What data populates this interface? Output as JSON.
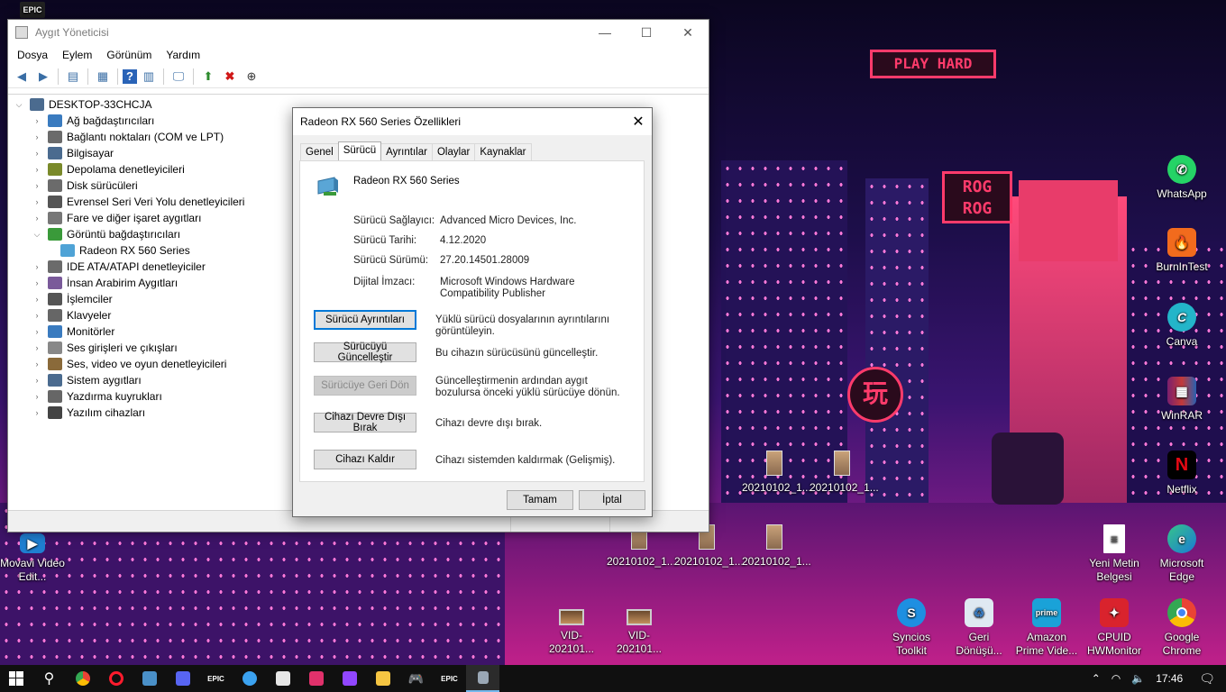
{
  "device_manager": {
    "title": "Aygıt Yöneticisi",
    "menu": [
      "Dosya",
      "Eylem",
      "Görünüm",
      "Yardım"
    ],
    "tree": {
      "root": "DESKTOP-33CHCJA",
      "items": [
        {
          "label": "Ağ bağdaştırıcıları",
          "icon": "network-icon",
          "expanded": false
        },
        {
          "label": "Bağlantı noktaları (COM ve LPT)",
          "icon": "port-icon",
          "expanded": false
        },
        {
          "label": "Bilgisayar",
          "icon": "computer-icon",
          "expanded": false
        },
        {
          "label": "Depolama denetleyicileri",
          "icon": "storage-icon",
          "expanded": false
        },
        {
          "label": "Disk sürücüleri",
          "icon": "disk-icon",
          "expanded": false
        },
        {
          "label": "Evrensel Seri Veri Yolu denetleyicileri",
          "icon": "usb-icon",
          "expanded": false
        },
        {
          "label": "Fare ve diğer işaret aygıtları",
          "icon": "mouse-icon",
          "expanded": false
        },
        {
          "label": "Görüntü bağdaştırıcıları",
          "icon": "display-adapter-icon",
          "expanded": true
        },
        {
          "label": "Radeon RX 560 Series",
          "icon": "gpu-icon",
          "child": true
        },
        {
          "label": "IDE ATA/ATAPI denetleyiciler",
          "icon": "ide-icon",
          "expanded": false
        },
        {
          "label": "İnsan Arabirim Aygıtları",
          "icon": "hid-icon",
          "expanded": false
        },
        {
          "label": "İşlemciler",
          "icon": "cpu-icon",
          "expanded": false
        },
        {
          "label": "Klavyeler",
          "icon": "keyboard-icon",
          "expanded": false
        },
        {
          "label": "Monitörler",
          "icon": "monitor-icon",
          "expanded": false
        },
        {
          "label": "Ses girişleri ve çıkışları",
          "icon": "speaker-icon",
          "expanded": false
        },
        {
          "label": "Ses, video ve oyun denetleyicileri",
          "icon": "sound-icon",
          "expanded": false
        },
        {
          "label": "Sistem aygıtları",
          "icon": "system-icon",
          "expanded": false
        },
        {
          "label": "Yazdırma kuyrukları",
          "icon": "printer-icon",
          "expanded": false
        },
        {
          "label": "Yazılım cihazları",
          "icon": "software-device-icon",
          "expanded": false
        }
      ]
    }
  },
  "dialog": {
    "title": "Radeon RX 560 Series Özellikleri",
    "tabs": [
      "Genel",
      "Sürücü",
      "Ayrıntılar",
      "Olaylar",
      "Kaynaklar"
    ],
    "active_tab": "Sürücü",
    "device_name": "Radeon RX 560 Series",
    "props": {
      "provider_label": "Sürücü Sağlayıcı:",
      "provider_value": "Advanced Micro Devices, Inc.",
      "date_label": "Sürücü Tarihi:",
      "date_value": "4.12.2020",
      "version_label": "Sürücü Sürümü:",
      "version_value": "27.20.14501.28009",
      "signer_label": "Dijital İmzacı:",
      "signer_value": "Microsoft Windows Hardware Compatibility Publisher"
    },
    "buttons": {
      "details": "Sürücü Ayrıntıları",
      "details_desc": "Yüklü sürücü dosyalarının ayrıntılarını görüntüleyin.",
      "update": "Sürücüyü Güncelleştir",
      "update_desc": "Bu cihazın sürücüsünü güncelleştir.",
      "rollback": "Sürücüye Geri Dön",
      "rollback_desc": "Güncelleştirmenin ardından aygıt bozulursa önceki yüklü sürücüye dönün.",
      "disable": "Cihazı Devre Dışı Bırak",
      "disable_desc": "Cihazı devre dışı bırak.",
      "uninstall": "Cihazı Kaldır",
      "uninstall_desc": "Cihazı sistemden kaldırmak (Gelişmiş).",
      "ok": "Tamam",
      "cancel": "İptal"
    }
  },
  "wallpaper": {
    "sign_play_hard": "PLAY HARD",
    "sign_rog_1": "ROG",
    "sign_rog_2": "ROG",
    "sign_kanji": "玩"
  },
  "desktop_icons": {
    "whatsapp": "WhatsApp",
    "burnintest": "BurnInTest",
    "canva": "Canva",
    "winrar": "WinRAR",
    "netflix": "Netflix",
    "edge": "Microsoft Edge",
    "yeni_metin": "Yeni Metin Belgesi",
    "chrome": "Google Chrome",
    "cpuid": "CPUID HWMonitor",
    "amazon": "Amazon Prime Vide...",
    "geri": "Geri Dönüşü...",
    "syncios": "Syncios Toolkit",
    "movavi": "Movavi Video Edit...",
    "img1": "20210102_1...",
    "img2": "20210102_1...",
    "img3": "20210102_1...",
    "img4": "20210102_1...",
    "img5": "20210102_1...",
    "vid1": "VID-202101...",
    "vid2": "VID-202101...",
    "epic_top": "EPIC"
  },
  "taskbar": {
    "clock": "17:46",
    "epic": "EPIC"
  },
  "colors": {
    "accent": "#0078d7",
    "neon_pink": "#ff3b6b"
  }
}
